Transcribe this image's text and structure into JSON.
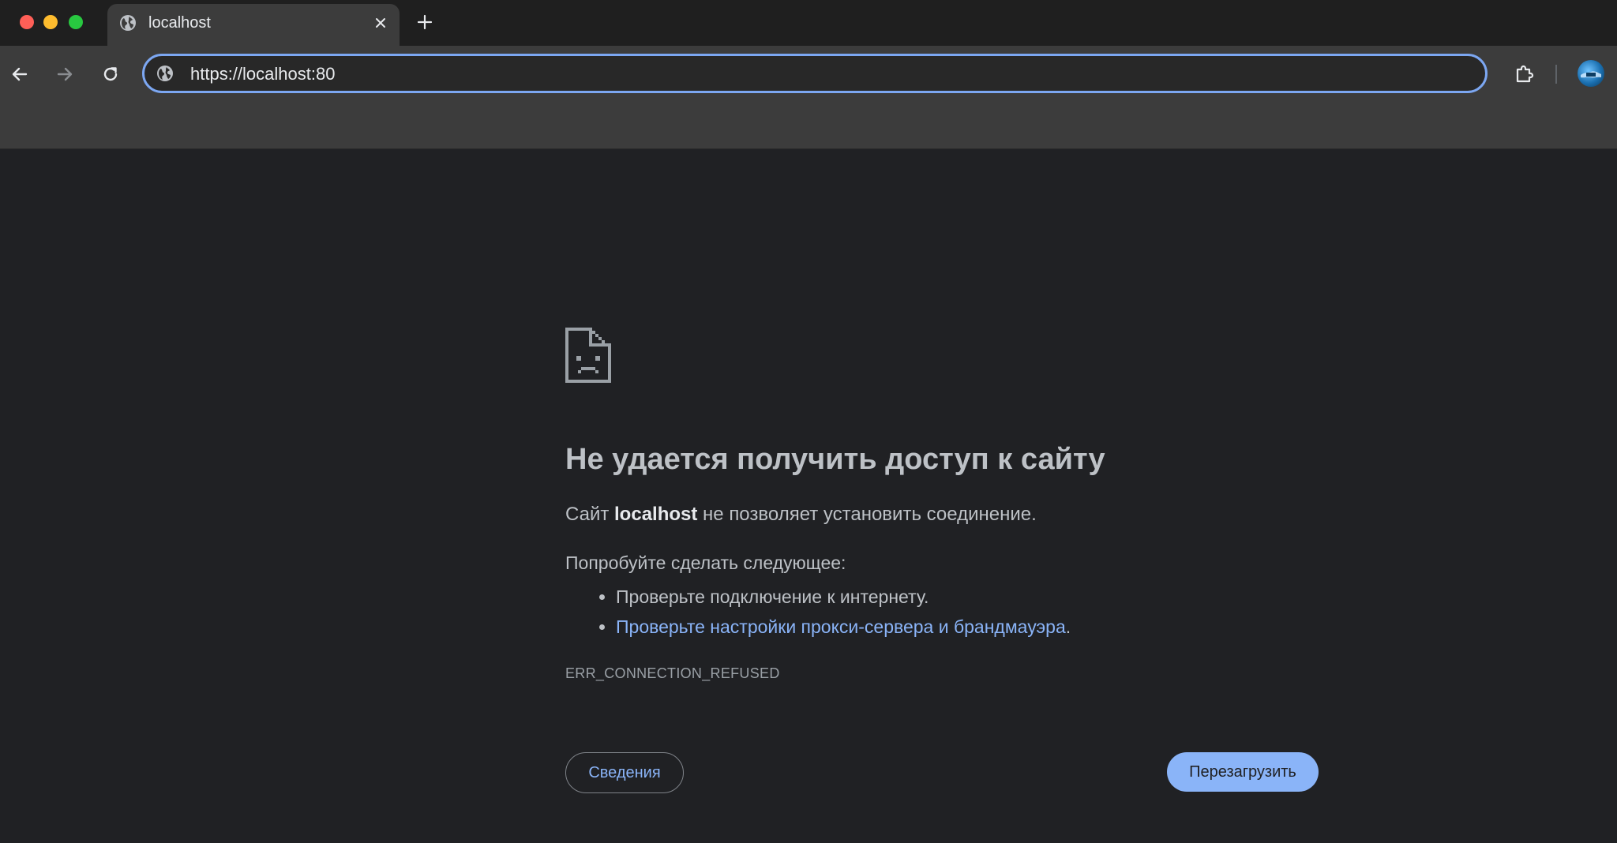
{
  "browser": {
    "tab": {
      "title": "localhost",
      "favicon": "globe-icon",
      "close_icon": "close-icon"
    },
    "new_tab_icon": "plus-icon",
    "window_controls": [
      "close",
      "minimize",
      "maximize"
    ],
    "toolbar": {
      "back_icon": "arrow-left-icon",
      "forward_icon": "arrow-right-icon",
      "reload_icon": "reload-icon",
      "site_info_icon": "globe-icon",
      "url": "https://localhost:80",
      "extensions_icon": "puzzle-icon",
      "avatar": "profile-avatar"
    }
  },
  "error_page": {
    "icon": "sad-file-icon",
    "title": "Не удается получить доступ к сайту",
    "description_prefix": "Сайт ",
    "host": "localhost",
    "description_suffix": " не позволяет установить соединение.",
    "try_heading": "Попробуйте сделать следующее:",
    "suggestion_1": "Проверьте подключение к интернету.",
    "suggestion_2_link": "Проверьте настройки прокси-сервера и брандмауэра",
    "suggestion_2_end": ".",
    "error_code": "ERR_CONNECTION_REFUSED",
    "details_button": "Сведения",
    "reload_button": "Перезагрузить"
  },
  "colors": {
    "page_background": "#202124",
    "accent": "#8ab4f8",
    "omnibox_focus_border": "#7ca7f2",
    "text": "#bdc1c6"
  }
}
